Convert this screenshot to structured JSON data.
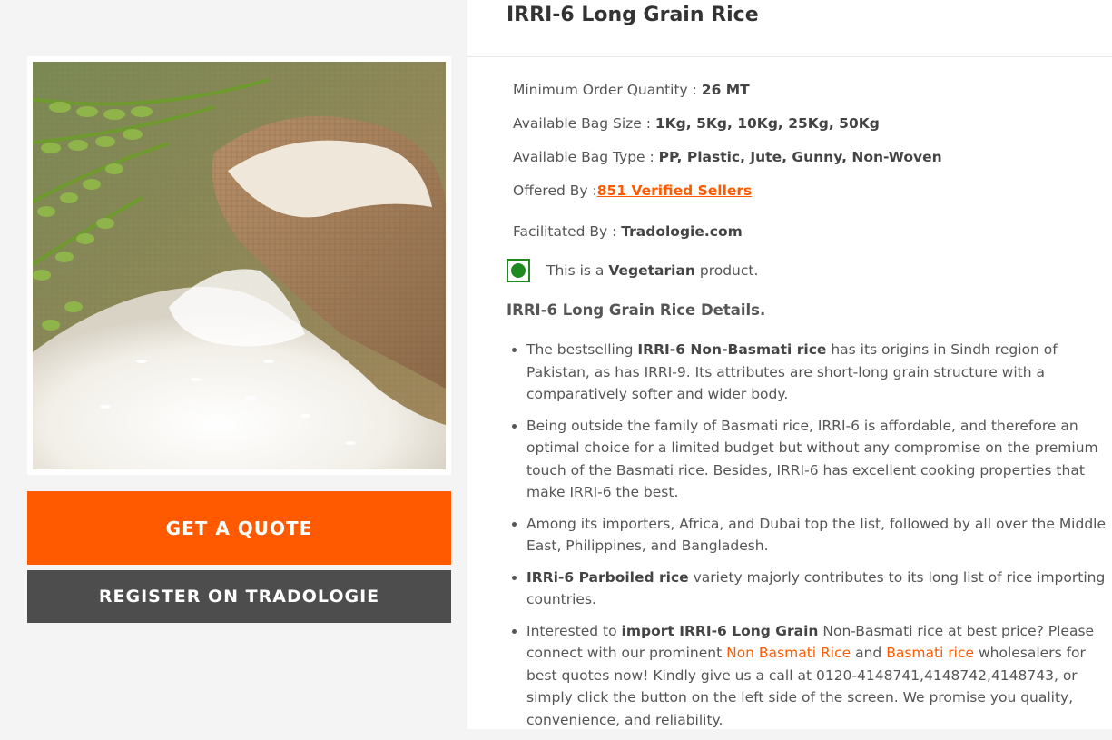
{
  "product": {
    "title": "IRRI-6 Long Grain Rice",
    "image_alt": "Burlap sack spilling white long grain rice with green rice stalks"
  },
  "buttons": {
    "quote": "GET A QUOTE",
    "register": "REGISTER ON TRADOLOGIE"
  },
  "specs": {
    "moq_label": "Minimum Order Quantity : ",
    "moq_value": "26 MT",
    "bag_size_label": "Available Bag Size : ",
    "bag_size_value": "1Kg, 5Kg, 10Kg, 25Kg, 50Kg",
    "bag_type_label": "Available Bag Type : ",
    "bag_type_value": "PP, Plastic, Jute, Gunny, Non-Woven",
    "offered_label": "Offered By :",
    "offered_value": "851 Verified Sellers",
    "facilitated_label": "Facilitated By : ",
    "facilitated_value": "Tradologie.com"
  },
  "veg": {
    "prefix": "This is a ",
    "bold": "Vegetarian",
    "suffix": " product."
  },
  "details": {
    "heading": "IRRI-6 Long Grain Rice Details.",
    "items": [
      {
        "t1": "The bestselling ",
        "b1": "IRRI-6 Non-Basmati rice",
        "t2": " has its origins in Sindh region of Pakistan, as has IRRI-9. Its attributes are short-long grain structure with a comparatively softer and wider body."
      },
      {
        "t1": "Being outside the family of Basmati rice, IRRI-6 is affordable, and therefore an optimal choice for a limited budget but without any compromise on the premium touch of the Basmati rice. Besides, IRRI-6 has excellent cooking properties that make IRRI-6 the best."
      },
      {
        "t1": "Among its importers, Africa, and Dubai top the list, followed by all over the Middle East, Philippines, and Bangladesh."
      },
      {
        "b1": "IRRi-6 Parboiled rice",
        "t1": " variety majorly contributes to its long list of rice importing countries."
      },
      {
        "t1": "Interested to ",
        "b1": "import IRRI-6 Long Grain",
        "t2": " Non-Basmati rice at best price? Please connect with our prominent ",
        "link1": "Non Basmati Rice",
        "t3": " and ",
        "link2": "Basmati rice",
        "t4": " wholesalers for best quotes now! Kindly give us a call at 0120-4148741,4148742,4148743, or simply click the button on the left side of the screen. We promise you quality, convenience, and reliability."
      }
    ]
  },
  "colors": {
    "accent": "#ff5a00",
    "dark_button": "#4d4d4d",
    "veg_green": "#1f8a1f"
  }
}
